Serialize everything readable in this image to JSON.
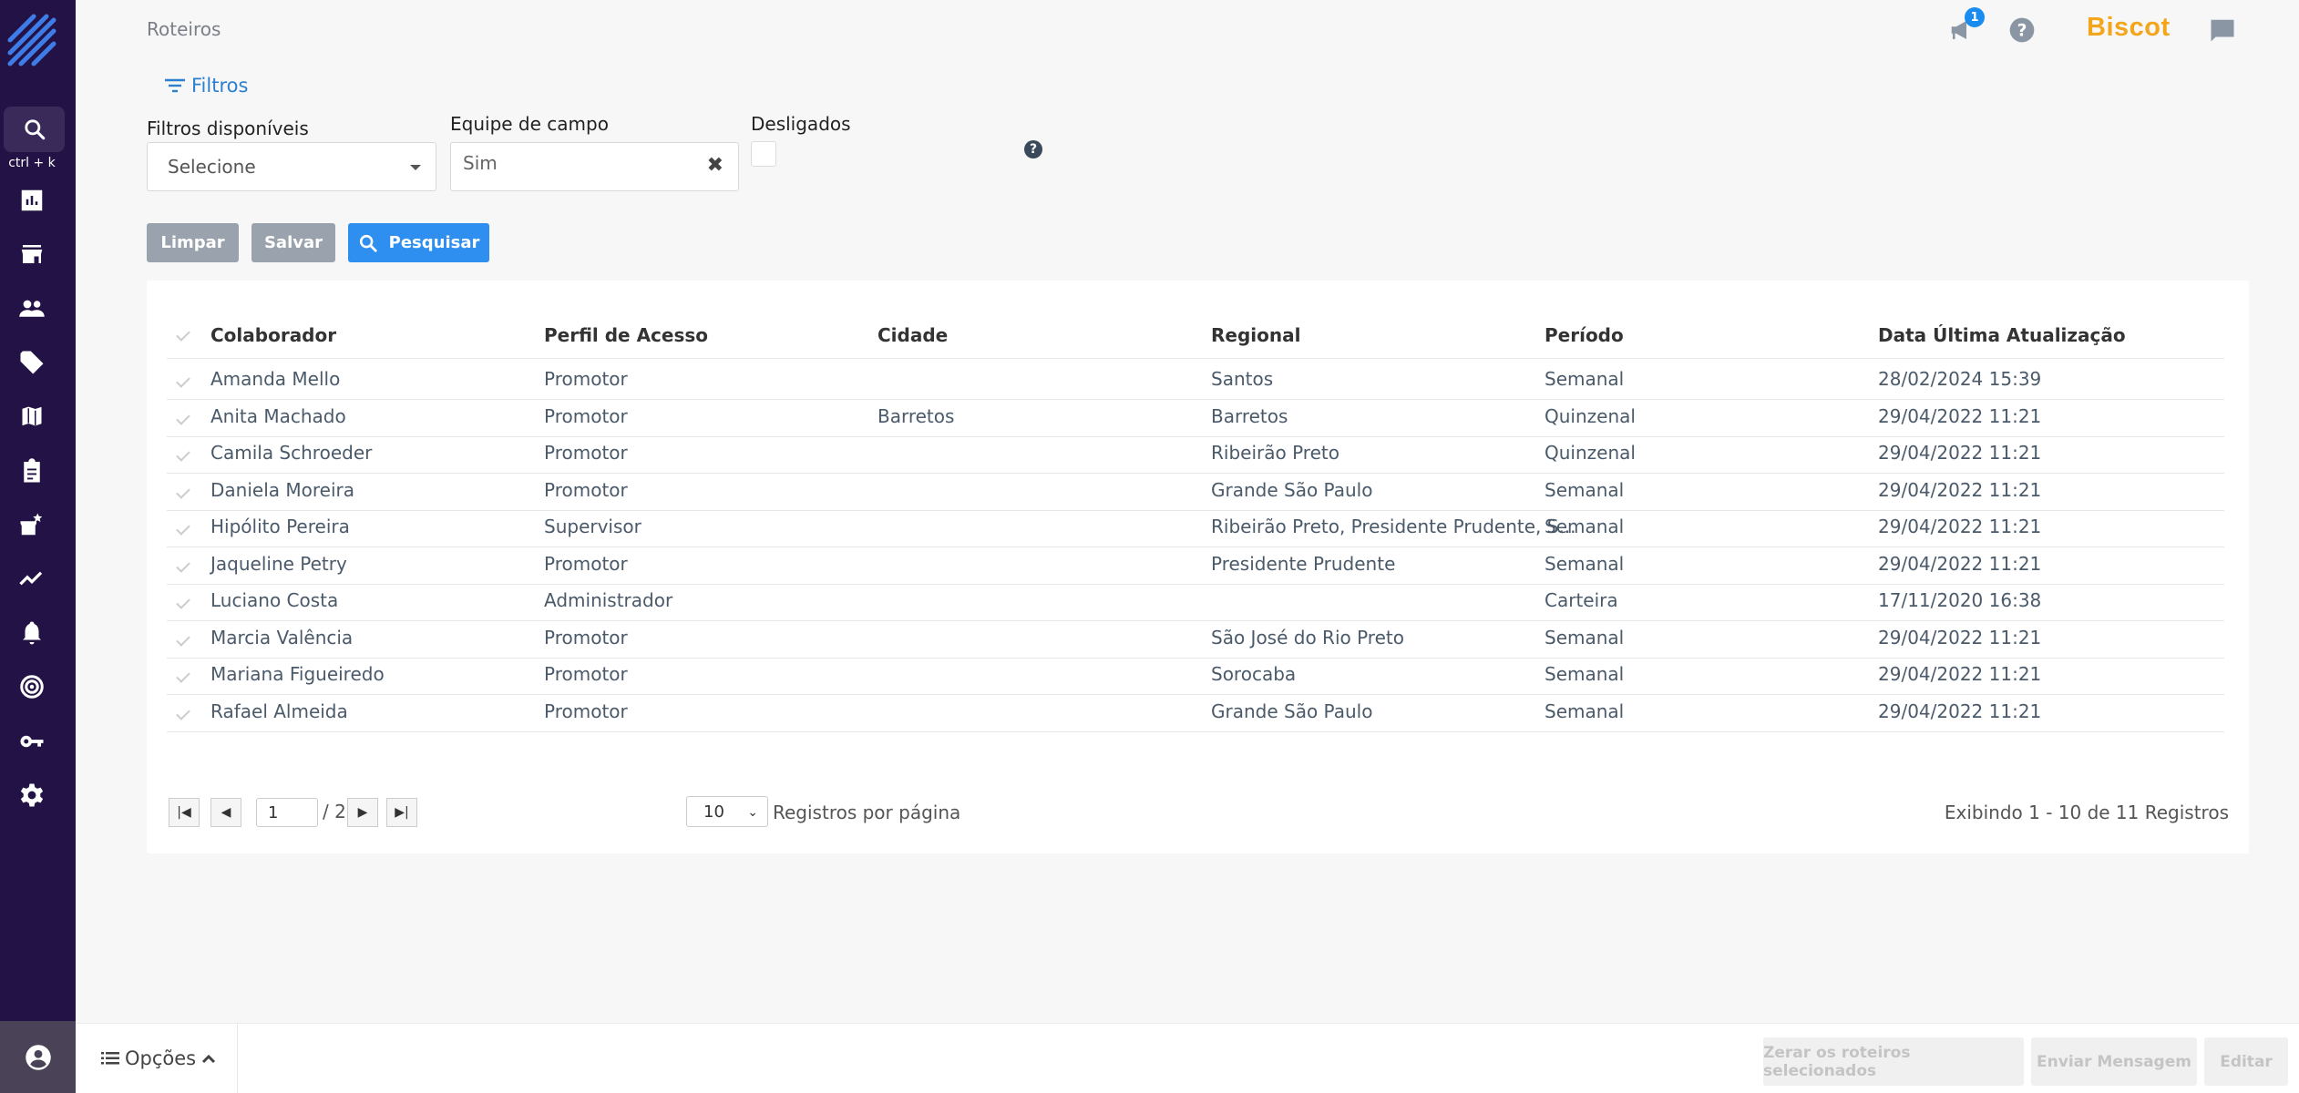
{
  "sidebar": {
    "search_hint": "ctrl + k",
    "items": [
      "search-icon",
      "dashboard-icon",
      "store-icon",
      "people-icon",
      "tag-icon",
      "map-icon",
      "clipboard-icon",
      "store-star-icon",
      "trend-icon",
      "bell-icon",
      "target-icon",
      "key-icon",
      "gear-icon"
    ]
  },
  "header": {
    "breadcrumb": "Roteiros",
    "notification_count": "1",
    "brand": "Biscot"
  },
  "filters": {
    "toggle_label": "Filtros",
    "available_label": "Filtros disponíveis",
    "available_value": "Selecione",
    "team_label": "Equipe de campo",
    "team_value": "Sim",
    "fired_label": "Desligados",
    "help": "?"
  },
  "actions": {
    "clear": "Limpar",
    "save": "Salvar",
    "search": "Pesquisar"
  },
  "table": {
    "columns": [
      "Colaborador",
      "Perfil de Acesso",
      "Cidade",
      "Regional",
      "Período",
      "Data Última Atualização"
    ],
    "rows": [
      [
        "Amanda Mello",
        "Promotor",
        "",
        "Santos",
        "Semanal",
        "28/02/2024 15:39"
      ],
      [
        "Anita Machado",
        "Promotor",
        "Barretos",
        "Barretos",
        "Quinzenal",
        "29/04/2022 11:21"
      ],
      [
        "Camila Schroeder",
        "Promotor",
        "",
        "Ribeirão Preto",
        "Quinzenal",
        "29/04/2022 11:21"
      ],
      [
        "Daniela Moreira",
        "Promotor",
        "",
        "Grande São Paulo",
        "Semanal",
        "29/04/2022 11:21"
      ],
      [
        "Hipólito Pereira",
        "Supervisor",
        "",
        "Ribeirão Preto, Presidente Prudente, S...",
        "Semanal",
        "29/04/2022 11:21"
      ],
      [
        "Jaqueline Petry",
        "Promotor",
        "",
        "Presidente Prudente",
        "Semanal",
        "29/04/2022 11:21"
      ],
      [
        "Luciano Costa",
        "Administrador",
        "",
        "",
        "Carteira",
        "17/11/2020 16:38"
      ],
      [
        "Marcia Valência",
        "Promotor",
        "",
        "São José do Rio Preto",
        "Semanal",
        "29/04/2022 11:21"
      ],
      [
        "Mariana Figueiredo",
        "Promotor",
        "",
        "Sorocaba",
        "Semanal",
        "29/04/2022 11:21"
      ],
      [
        "Rafael Almeida",
        "Promotor",
        "",
        "Grande São Paulo",
        "Semanal",
        "29/04/2022 11:21"
      ]
    ]
  },
  "pagination": {
    "current_page": "1",
    "total_pages": "/ 2",
    "per_page": "10",
    "per_page_label": "Registros por página",
    "showing": "Exibindo 1 - 10 de 11 Registros"
  },
  "footer": {
    "options_label": "Opções",
    "reset_button": "Zerar os roteiros selecionados",
    "message_button": "Enviar Mensagem",
    "edit_button": "Editar"
  },
  "colors": {
    "sidebar": "#231245",
    "accent": "#2e8ff0",
    "brand": "#f3a51b"
  }
}
